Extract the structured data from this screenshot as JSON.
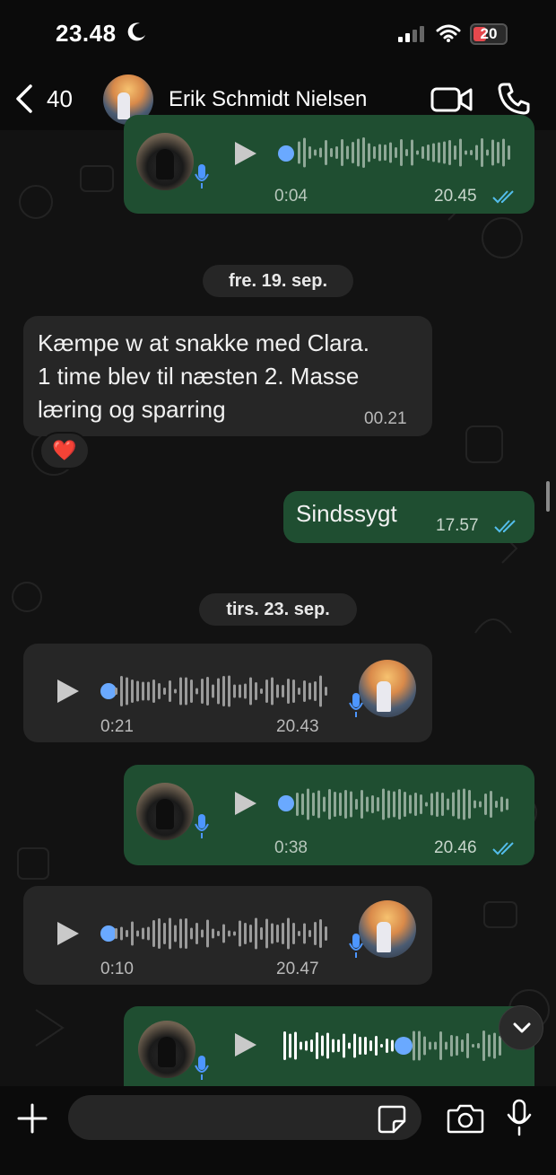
{
  "status_bar": {
    "time": "23.48",
    "battery": "20"
  },
  "header": {
    "back_count": "40",
    "contact_name": "Erik Schmidt Nielsen"
  },
  "messages": [
    {
      "type": "voice",
      "direction": "outgoing",
      "duration": "0:04",
      "time": "20.45",
      "status": "read"
    },
    {
      "type": "date",
      "label": "fre. 19. sep."
    },
    {
      "type": "text",
      "direction": "incoming",
      "lines": [
        "Kæmpe w at snakke med Clara.",
        "1 time blev til næsten 2. Masse",
        "læring og sparring"
      ],
      "time": "00.21",
      "reaction": "❤️"
    },
    {
      "type": "text",
      "direction": "outgoing",
      "text": "Sindssygt",
      "time": "17.57",
      "status": "read"
    },
    {
      "type": "date",
      "label": "tirs. 23. sep."
    },
    {
      "type": "voice",
      "direction": "incoming",
      "duration": "0:21",
      "time": "20.43"
    },
    {
      "type": "voice",
      "direction": "outgoing",
      "duration": "0:38",
      "time": "20.46",
      "status": "read"
    },
    {
      "type": "voice",
      "direction": "incoming",
      "duration": "0:10",
      "time": "20.47"
    },
    {
      "type": "voice",
      "direction": "outgoing",
      "status": "playing"
    }
  ],
  "composer": {
    "placeholder": ""
  },
  "colors": {
    "outgoing_bubble": "#1f4e31",
    "incoming_bubble": "#262626",
    "read_tick": "#53bdeb",
    "playhead": "#6aa9ff",
    "battery_low": "#e5484d"
  }
}
